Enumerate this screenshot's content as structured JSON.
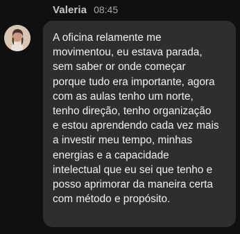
{
  "message": {
    "author": "Valeria",
    "time": "08:45",
    "avatar_icon": "avatar-photo",
    "lines": [
      "A oficina relamente me",
      "movimentou, eu estava parada,",
      "sem saber or onde começar",
      "porque tudo era importante, agora",
      "com as aulas tenho um norte,",
      "tenho direção, tenho organização",
      "e estou aprendendo cada vez mais",
      "a investir meu tempo, minhas",
      "energias e a capacidade",
      "intelectual que eu sei que tenho e",
      "posso aprimorar da maneira certa",
      "com método e propósito."
    ]
  },
  "colors": {
    "background": "#101010",
    "bubble": "#2e2e2e",
    "text": "#f1f1f1",
    "author": "#c9c9c9",
    "time": "#a8a8a8"
  }
}
